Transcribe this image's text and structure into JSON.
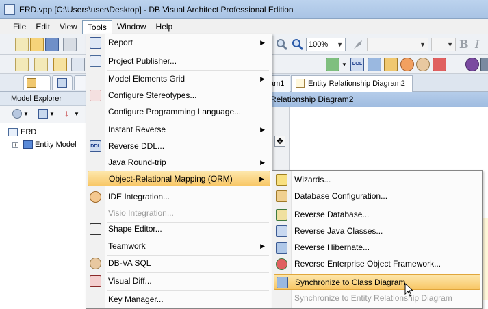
{
  "window": {
    "title": "ERD.vpp [C:\\Users\\user\\Desktop] - DB Visual Architect Professional Edition"
  },
  "menubar": {
    "items": [
      "File",
      "Edit",
      "View",
      "Tools",
      "Window",
      "Help"
    ],
    "active": "Tools"
  },
  "toolbar": {
    "zoom_value": "100%",
    "bold_label": "B",
    "italic_label": "I"
  },
  "left_panel": {
    "header": "Model Explorer",
    "tree": [
      {
        "label": "ERD",
        "icon": "project-icon"
      },
      {
        "label": "Entity Model",
        "icon": "entity-model-icon"
      }
    ]
  },
  "diagram": {
    "tabs": [
      {
        "label": "am1"
      },
      {
        "label": "Entity Relationship Diagram2"
      }
    ],
    "header": "Relationship Diagram2"
  },
  "tools_menu": {
    "items": [
      {
        "label": "Report",
        "submenu": true,
        "icon": "report-icon"
      },
      {
        "label": "Project Publisher...",
        "icon": "publisher-icon"
      },
      {
        "label": "Model Elements Grid",
        "submenu": true
      },
      {
        "label": "Configure Stereotypes...",
        "icon": "stereotype-icon"
      },
      {
        "label": "Configure Programming Language..."
      },
      {
        "label": "Instant Reverse",
        "submenu": true
      },
      {
        "label": "Reverse DDL...",
        "icon": "ddl-icon"
      },
      {
        "label": "Java Round-trip",
        "submenu": true
      },
      {
        "label": "Object-Relational Mapping (ORM)",
        "submenu": true,
        "highlighted": true
      },
      {
        "label": "IDE Integration...",
        "icon": "ide-icon"
      },
      {
        "label": "Visio Integration...",
        "disabled": true
      },
      {
        "label": "Shape Editor...",
        "icon": "shape-editor-icon"
      },
      {
        "label": "Teamwork",
        "submenu": true
      },
      {
        "label": "DB-VA SQL",
        "icon": "sql-icon"
      },
      {
        "label": "Visual Diff...",
        "icon": "diff-icon"
      },
      {
        "label": "Key Manager..."
      }
    ]
  },
  "orm_submenu": {
    "items": [
      {
        "label": "Wizards...",
        "icon": "wizard-icon"
      },
      {
        "label": "Database Configuration...",
        "icon": "db-config-icon"
      },
      {
        "label": "Reverse Database...",
        "icon": "reverse-db-icon"
      },
      {
        "label": "Reverse Java Classes...",
        "icon": "reverse-java-icon"
      },
      {
        "label": "Reverse Hibernate...",
        "icon": "reverse-hibernate-icon"
      },
      {
        "label": "Reverse Enterprise Object Framework...",
        "icon": "reverse-eof-icon"
      },
      {
        "label": "Synchronize to Class Diagram",
        "icon": "sync-class-icon",
        "highlighted": true
      },
      {
        "label": "Synchronize to Entity Relationship Diagram",
        "disabled": true
      }
    ]
  },
  "colors": {
    "highlight": "#f8c766",
    "menu_bg": "#fbfbfb",
    "title_bg": "#a9c3e4"
  }
}
